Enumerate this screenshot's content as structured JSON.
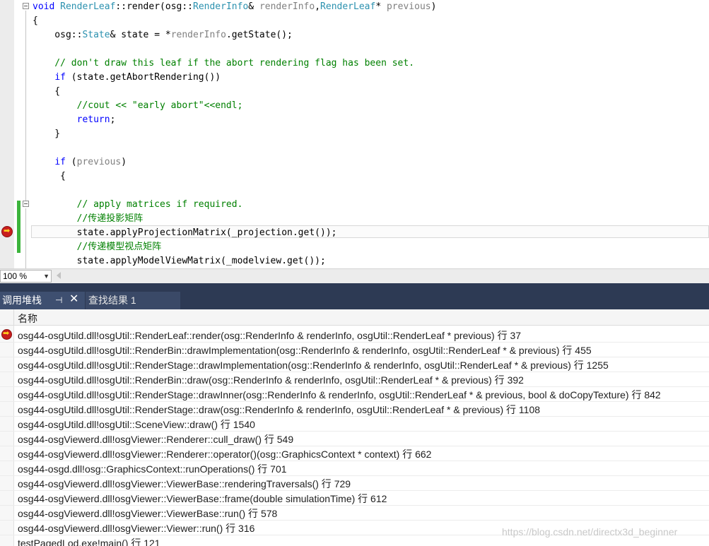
{
  "editor": {
    "lines": [
      {
        "segments": [
          {
            "t": "void ",
            "c": "kw"
          },
          {
            "t": "RenderLeaf",
            "c": "ty"
          },
          {
            "t": "::render(osg::",
            "c": ""
          },
          {
            "t": "RenderInfo",
            "c": "ty"
          },
          {
            "t": "& ",
            "c": ""
          },
          {
            "t": "renderInfo",
            "c": "pr"
          },
          {
            "t": ",",
            "c": ""
          },
          {
            "t": "RenderLeaf",
            "c": "ty"
          },
          {
            "t": "* ",
            "c": ""
          },
          {
            "t": "previous",
            "c": "pr"
          },
          {
            "t": ")",
            "c": ""
          }
        ]
      },
      {
        "segments": [
          {
            "t": "{",
            "c": ""
          }
        ]
      },
      {
        "segments": [
          {
            "t": "    osg::",
            "c": ""
          },
          {
            "t": "State",
            "c": "ty"
          },
          {
            "t": "& state = *",
            "c": ""
          },
          {
            "t": "renderInfo",
            "c": "pr"
          },
          {
            "t": ".getState();",
            "c": ""
          }
        ]
      },
      {
        "segments": [
          {
            "t": "",
            "c": ""
          }
        ]
      },
      {
        "segments": [
          {
            "t": "    // don't draw this leaf if the abort rendering flag has been set.",
            "c": "cm"
          }
        ]
      },
      {
        "segments": [
          {
            "t": "    ",
            "c": ""
          },
          {
            "t": "if",
            "c": "kw"
          },
          {
            "t": " (state.getAbortRendering())",
            "c": ""
          }
        ]
      },
      {
        "segments": [
          {
            "t": "    {",
            "c": ""
          }
        ]
      },
      {
        "segments": [
          {
            "t": "        //cout << \"early abort\"<<endl;",
            "c": "cm"
          }
        ]
      },
      {
        "segments": [
          {
            "t": "        ",
            "c": ""
          },
          {
            "t": "return",
            "c": "kw"
          },
          {
            "t": ";",
            "c": ""
          }
        ]
      },
      {
        "segments": [
          {
            "t": "    }",
            "c": ""
          }
        ]
      },
      {
        "segments": [
          {
            "t": "",
            "c": ""
          }
        ]
      },
      {
        "segments": [
          {
            "t": "    ",
            "c": ""
          },
          {
            "t": "if",
            "c": "kw"
          },
          {
            "t": " (",
            "c": ""
          },
          {
            "t": "previous",
            "c": "pr"
          },
          {
            "t": ")",
            "c": ""
          }
        ]
      },
      {
        "segments": [
          {
            "t": "     {",
            "c": ""
          }
        ]
      },
      {
        "segments": [
          {
            "t": "",
            "c": ""
          }
        ]
      },
      {
        "segments": [
          {
            "t": "        // apply matrices if required.",
            "c": "cm"
          }
        ]
      },
      {
        "segments": [
          {
            "t": "        //传递投影矩阵",
            "c": "cm"
          }
        ]
      },
      {
        "segments": [
          {
            "t": "        state.applyProjectionMatrix(_projection.get());",
            "c": ""
          }
        ]
      },
      {
        "segments": [
          {
            "t": "        //传递模型视点矩阵",
            "c": "cm"
          }
        ]
      },
      {
        "segments": [
          {
            "t": "        state.applyModelViewMatrix(_modelview.get());",
            "c": ""
          }
        ]
      }
    ]
  },
  "status": {
    "zoom": "100 %"
  },
  "tabs": {
    "callstack": "调用堆栈",
    "findresults": "查找结果 1",
    "pin_icon": "pin-icon",
    "close_icon": "close-icon"
  },
  "callstack": {
    "header": "名称",
    "rows": [
      "osg44-osgUtild.dll!osgUtil::RenderLeaf::render(osg::RenderInfo & renderInfo, osgUtil::RenderLeaf * previous) 行 37",
      "osg44-osgUtild.dll!osgUtil::RenderBin::drawImplementation(osg::RenderInfo & renderInfo, osgUtil::RenderLeaf * & previous) 行 455",
      "osg44-osgUtild.dll!osgUtil::RenderStage::drawImplementation(osg::RenderInfo & renderInfo, osgUtil::RenderLeaf * & previous) 行 1255",
      "osg44-osgUtild.dll!osgUtil::RenderBin::draw(osg::RenderInfo & renderInfo, osgUtil::RenderLeaf * & previous) 行 392",
      "osg44-osgUtild.dll!osgUtil::RenderStage::drawInner(osg::RenderInfo & renderInfo, osgUtil::RenderLeaf * & previous, bool & doCopyTexture) 行 842",
      "osg44-osgUtild.dll!osgUtil::RenderStage::draw(osg::RenderInfo & renderInfo, osgUtil::RenderLeaf * & previous) 行 1108",
      "osg44-osgUtild.dll!osgUtil::SceneView::draw() 行 1540",
      "osg44-osgViewerd.dll!osgViewer::Renderer::cull_draw() 行 549",
      "osg44-osgViewerd.dll!osgViewer::Renderer::operator()(osg::GraphicsContext * context) 行 662",
      "osg44-osgd.dll!osg::GraphicsContext::runOperations() 行 701",
      "osg44-osgViewerd.dll!osgViewer::ViewerBase::renderingTraversals() 行 729",
      "osg44-osgViewerd.dll!osgViewer::ViewerBase::frame(double simulationTime) 行 612",
      "osg44-osgViewerd.dll!osgViewer::ViewerBase::run() 行 578",
      "osg44-osgViewerd.dll!osgViewer::Viewer::run() 行 316",
      "testPagedLod.exe!main() 行 121"
    ]
  },
  "watermark": "https://blog.csdn.net/directx3d_beginner"
}
